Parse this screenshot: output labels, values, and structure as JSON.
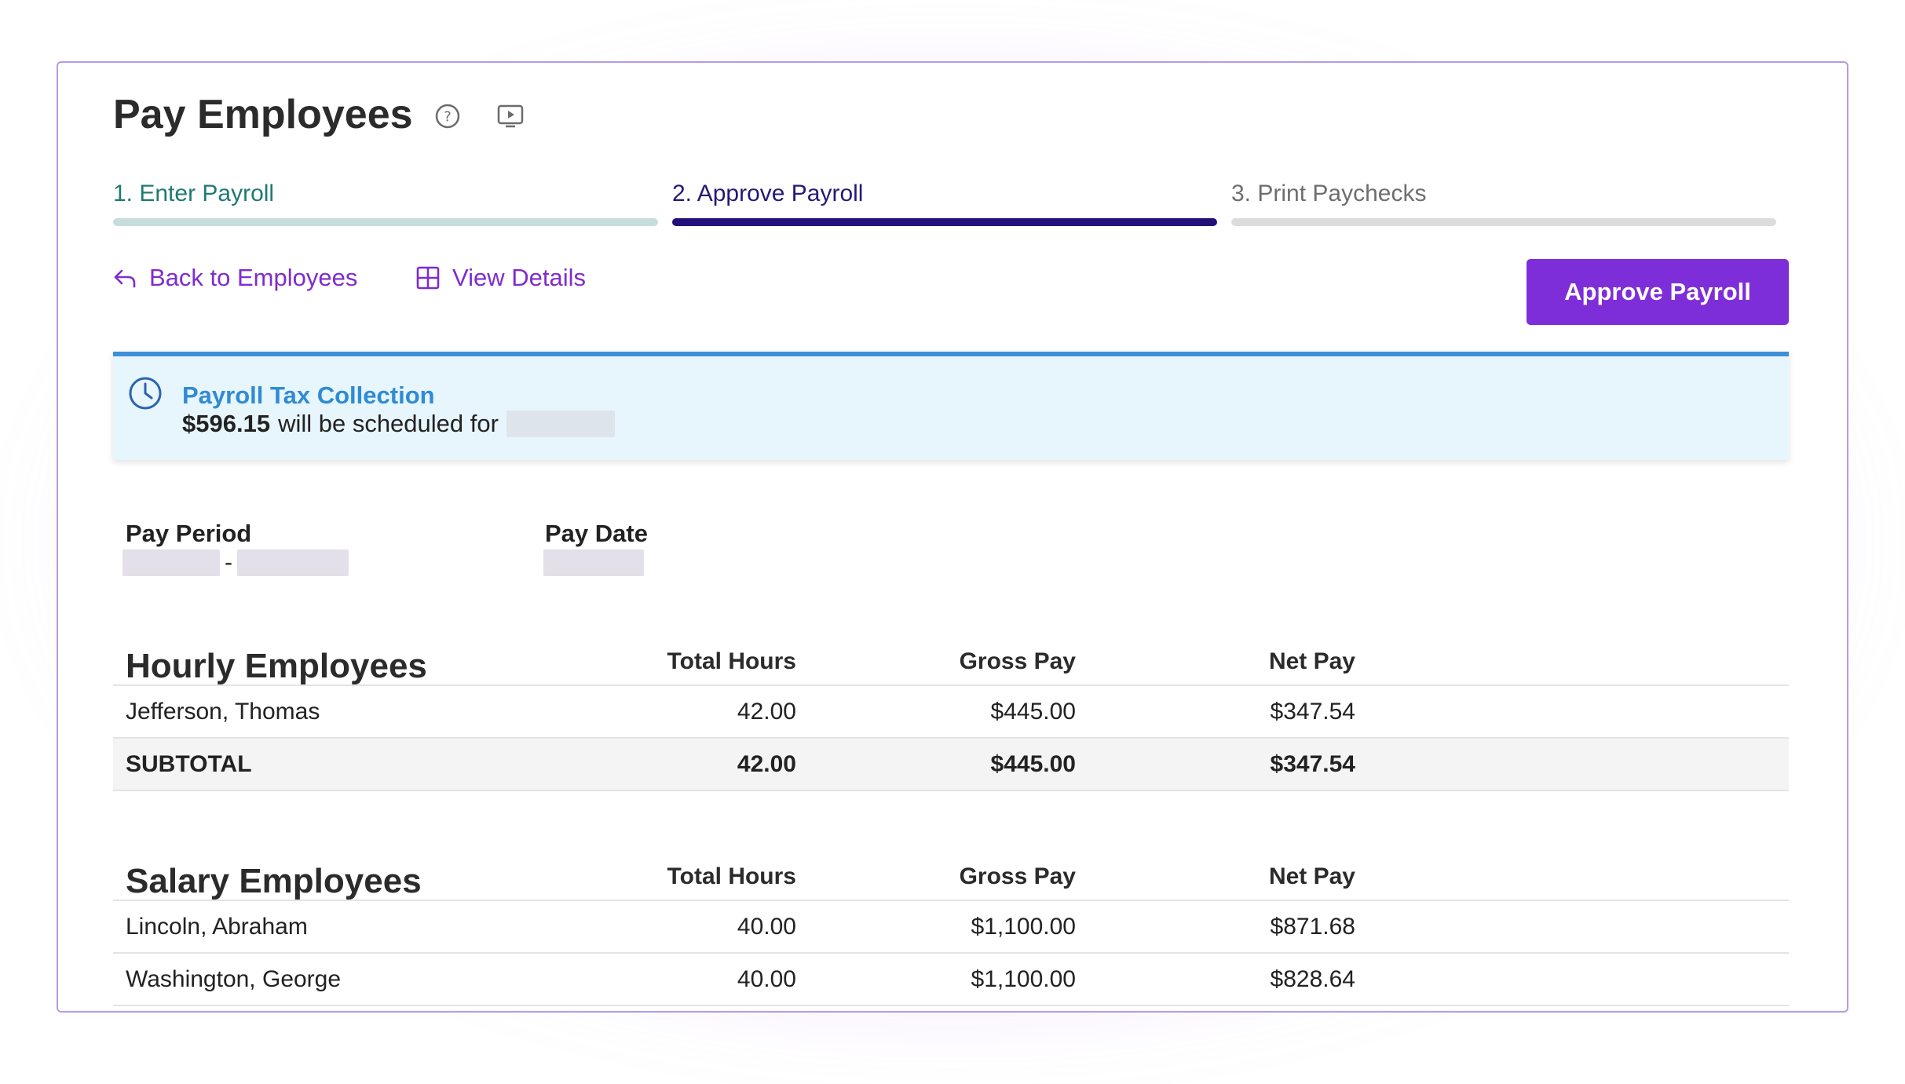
{
  "header": {
    "title": "Pay Employees",
    "icons": [
      "help-icon",
      "video-icon"
    ]
  },
  "steps": [
    {
      "label": "1. Enter Payroll",
      "state": "complete"
    },
    {
      "label": "2. Approve Payroll",
      "state": "current"
    },
    {
      "label": "3. Print Paychecks",
      "state": "upcoming"
    }
  ],
  "actions": {
    "back_label": "Back to Employees",
    "details_label": "View Details",
    "approve_label": "Approve Payroll"
  },
  "alert": {
    "title": "Payroll Tax Collection",
    "amount": "$596.15",
    "text": "will be scheduled for"
  },
  "meta": {
    "pay_period_label": "Pay Period",
    "pay_period_sep": "-",
    "pay_date_label": "Pay Date"
  },
  "hourly": {
    "title": "Hourly Employees",
    "columns": [
      "Total Hours",
      "Gross Pay",
      "Net Pay"
    ],
    "rows": [
      {
        "name": "Jefferson, Thomas",
        "hours": "42.00",
        "gross": "$445.00",
        "net": "$347.54"
      }
    ],
    "subtotal": {
      "label": "SUBTOTAL",
      "hours": "42.00",
      "gross": "$445.00",
      "net": "$347.54"
    }
  },
  "salary": {
    "title": "Salary Employees",
    "columns": [
      "Total Hours",
      "Gross Pay",
      "Net Pay"
    ],
    "rows": [
      {
        "name": "Lincoln, Abraham",
        "hours": "40.00",
        "gross": "$1,100.00",
        "net": "$871.68"
      },
      {
        "name": "Washington, George",
        "hours": "40.00",
        "gross": "$1,100.00",
        "net": "$828.64"
      }
    ]
  },
  "colors": {
    "accent": "#7e2ed9",
    "step_current": "#24107a",
    "step_complete": "#1f7a73",
    "alert_blue": "#2f8bd5"
  }
}
